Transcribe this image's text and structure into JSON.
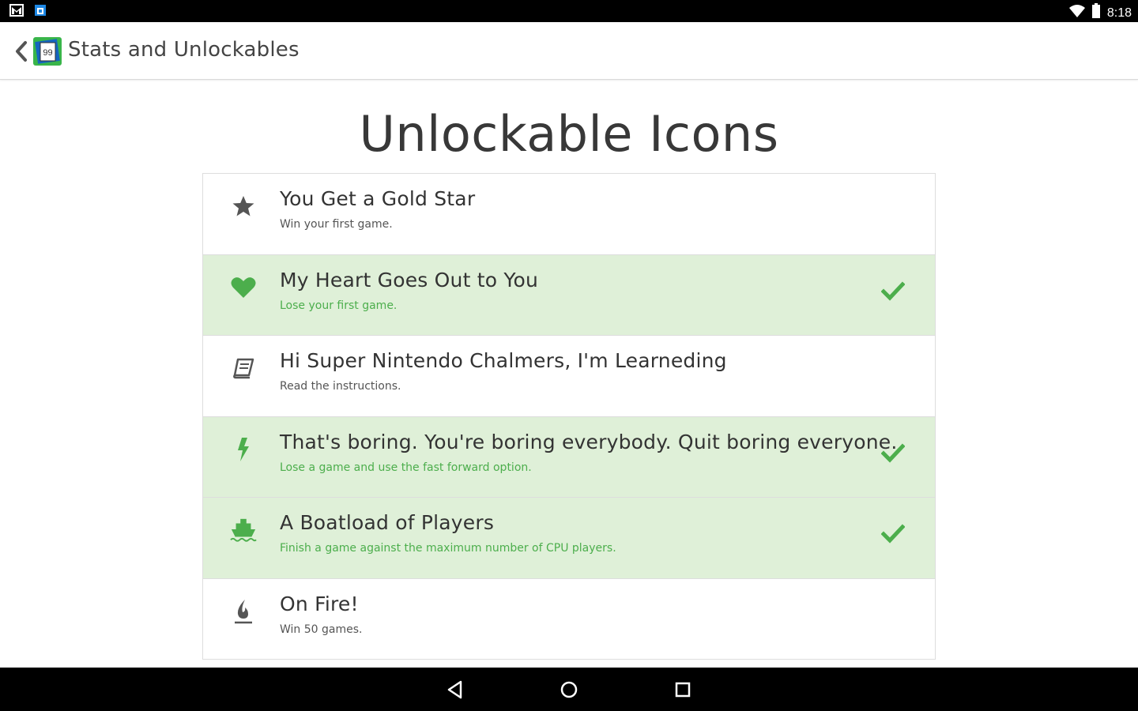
{
  "status_bar": {
    "time": "8:18",
    "left_icons": [
      "gmail-icon",
      "app-notification-icon"
    ],
    "right_icons": [
      "wifi-icon",
      "battery-icon"
    ]
  },
  "app_bar": {
    "title": "Stats and Unlockables",
    "logo_text": "99"
  },
  "page": {
    "heading": "Unlockable Icons"
  },
  "unlockables": [
    {
      "icon": "star-icon",
      "title": "You Get a Gold Star",
      "description": "Win your first game.",
      "unlocked": false
    },
    {
      "icon": "heart-icon",
      "title": "My Heart Goes Out to You",
      "description": "Lose your first game.",
      "unlocked": true
    },
    {
      "icon": "book-icon",
      "title": "Hi Super Nintendo Chalmers, I'm Learneding",
      "description": "Read the instructions.",
      "unlocked": false
    },
    {
      "icon": "lightning-icon",
      "title": "That's boring. You're boring everybody. Quit boring everyone.",
      "description": "Lose a game and use the fast forward option.",
      "unlocked": true
    },
    {
      "icon": "ship-icon",
      "title": "A Boatload of Players",
      "description": "Finish a game against the maximum number of CPU players.",
      "unlocked": true
    },
    {
      "icon": "fire-icon",
      "title": "On Fire!",
      "description": "Win 50 games.",
      "unlocked": false
    }
  ],
  "colors": {
    "unlocked_bg": "#dff0d8",
    "accent_green": "#4cae4c",
    "icon_gray": "#555555"
  }
}
